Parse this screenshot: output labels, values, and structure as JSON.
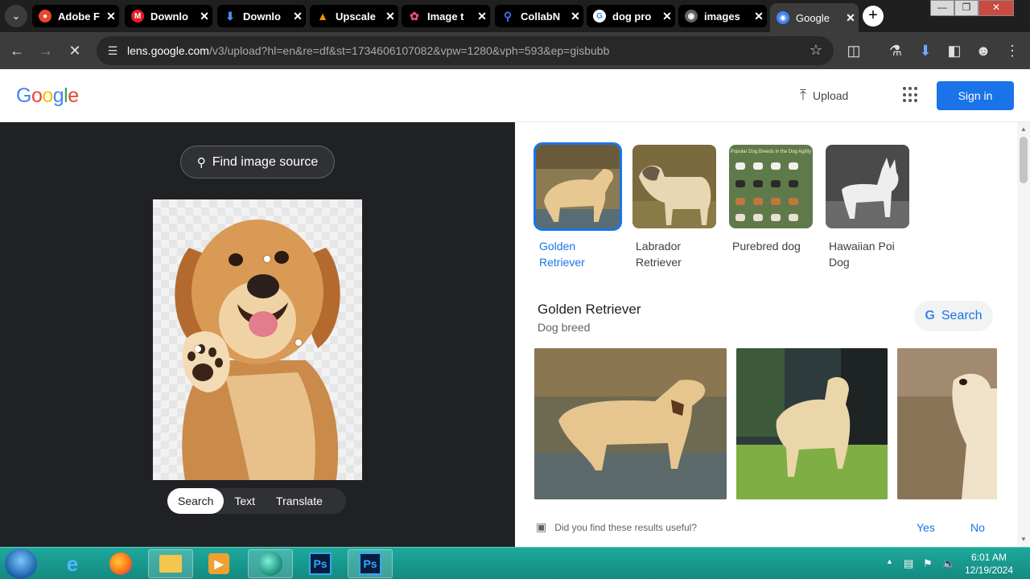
{
  "browser": {
    "tabs": [
      {
        "title": "Adobe F",
        "favicon": "adobe-icon",
        "color": "#e8472b",
        "active": false
      },
      {
        "title": "Downlo",
        "favicon": "m-icon",
        "color": "#e21f27",
        "active": false
      },
      {
        "title": "Downlo",
        "favicon": "download-arrow-icon",
        "color": "#1a73e8",
        "active": false
      },
      {
        "title": "Upscale",
        "favicon": "upscale-icon",
        "color": "#f29900",
        "active": false
      },
      {
        "title": "Image t",
        "favicon": "octopus-icon",
        "color": "#ea4c89",
        "active": false
      },
      {
        "title": "CollabN",
        "favicon": "search-q-icon",
        "color": "#4c6ef5",
        "active": false
      },
      {
        "title": "dog pro",
        "favicon": "google-g-icon",
        "color": "#ffffff",
        "active": false
      },
      {
        "title": "images",
        "favicon": "globe-icon",
        "color": "#9aa0a6",
        "active": false
      },
      {
        "title": "Google",
        "favicon": "lens-icon",
        "color": "#4285f4",
        "active": true
      }
    ],
    "url_host": "lens.google.com",
    "url_rest": "/v3/upload?hl=en&re=df&st=1734606107082&vpw=1280&vph=593&ep=gisbubb"
  },
  "header": {
    "logo": "Google",
    "upload_label": "Upload",
    "signin_label": "Sign in"
  },
  "left": {
    "find_source_label": "Find image source",
    "modes": [
      "Search",
      "Text",
      "Translate"
    ],
    "active_mode": "Search"
  },
  "entities": [
    {
      "label": "Golden Retriever",
      "selected": true
    },
    {
      "label": "Labrador Retriever",
      "selected": false
    },
    {
      "label": "Purebred dog",
      "selected": false
    },
    {
      "label": "Hawaiian Poi Dog",
      "selected": false
    }
  ],
  "purebred_thumb_text": "Popular Dog Breeds in the Dog Agility",
  "knowledge": {
    "title": "Golden Retriever",
    "subtitle": "Dog breed",
    "search_label": "Search"
  },
  "feedback": {
    "question": "Did you find these results useful?",
    "yes": "Yes",
    "no": "No"
  },
  "taskbar": {
    "time": "6:01 AM",
    "date": "12/19/2024",
    "ps_label": "Ps"
  },
  "colors": {
    "accent": "#1a73e8",
    "dark_pane": "#202124",
    "taskbar": "#17968c"
  }
}
